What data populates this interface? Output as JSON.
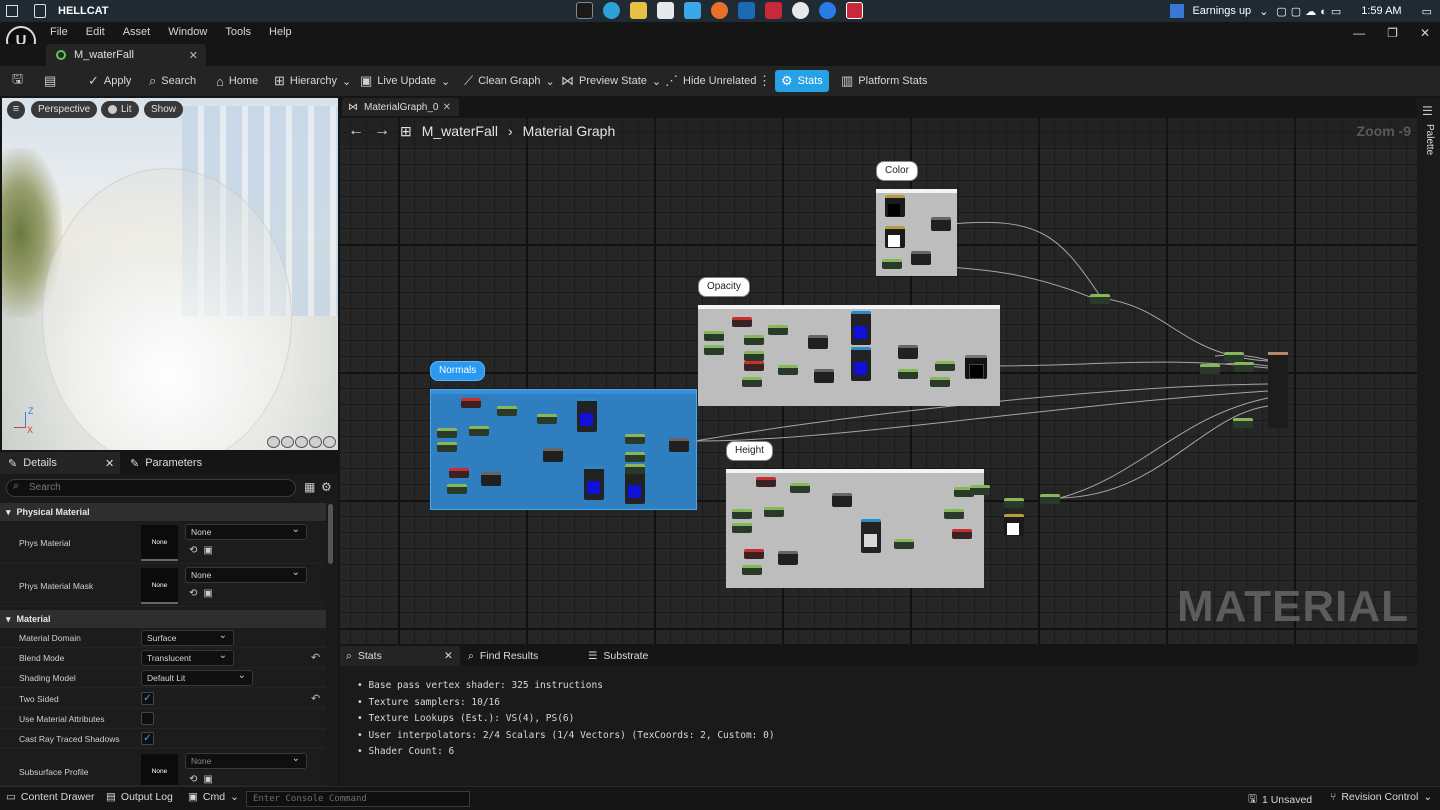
{
  "taskbar": {
    "window_title": "HELLCAT",
    "weather_text": "Earnings up",
    "time": "1:59 AM"
  },
  "menubar": {
    "logo": "U",
    "items": [
      "File",
      "Edit",
      "Asset",
      "Window",
      "Tools",
      "Help"
    ]
  },
  "asset_tab": {
    "label": "M_waterFall"
  },
  "toolbar": {
    "apply": "Apply",
    "search": "Search",
    "home": "Home",
    "hierarchy": "Hierarchy",
    "live_update": "Live Update",
    "clean_graph": "Clean Graph",
    "preview_state": "Preview State",
    "hide_unrelated": "Hide Unrelated",
    "stats": "Stats",
    "platform_stats": "Platform Stats"
  },
  "viewport": {
    "perspective": "Perspective",
    "lit": "Lit",
    "show": "Show",
    "axis_z": "Z",
    "axis_x": "X"
  },
  "details": {
    "tab_details": "Details",
    "tab_parameters": "Parameters",
    "search_placeholder": "Search",
    "section_physical": "Physical Material",
    "phys_material": {
      "label": "Phys Material",
      "thumb": "None",
      "value": "None"
    },
    "phys_material_mask": {
      "label": "Phys Material Mask",
      "thumb": "None",
      "value": "None"
    },
    "section_material": "Material",
    "material_domain": {
      "label": "Material Domain",
      "value": "Surface"
    },
    "blend_mode": {
      "label": "Blend Mode",
      "value": "Translucent"
    },
    "shading_model": {
      "label": "Shading Model",
      "value": "Default Lit"
    },
    "two_sided": {
      "label": "Two Sided",
      "checked": true
    },
    "use_material_attributes": {
      "label": "Use Material Attributes",
      "checked": false
    },
    "cast_ray_traced_shadows": {
      "label": "Cast Ray Traced Shadows",
      "checked": true
    },
    "subsurface_profile": {
      "label": "Subsurface Profile",
      "thumb": "None",
      "value": "None"
    }
  },
  "graph": {
    "tab_label": "MaterialGraph_0",
    "breadcrumb_asset": "M_waterFall",
    "breadcrumb_graph": "Material Graph",
    "zoom": "Zoom -9",
    "watermark": "MATERIAL",
    "comments": [
      "Color",
      "Opacity",
      "Normals",
      "Height"
    ]
  },
  "palette": {
    "label": "Palette"
  },
  "stats_panel": {
    "tab_stats": "Stats",
    "tab_find": "Find Results",
    "tab_substrate": "Substrate",
    "lines": [
      "Base pass vertex shader: 325 instructions",
      "Texture samplers: 10/16",
      "Texture Lookups (Est.): VS(4), PS(6)",
      "User interpolators: 2/4 Scalars (1/4 Vectors) (TexCoords: 2, Custom: 0)",
      "Shader Count: 6"
    ]
  },
  "statusbar": {
    "content_drawer": "Content Drawer",
    "output_log": "Output Log",
    "cmd": "Cmd",
    "console_placeholder": "Enter Console Command",
    "unsaved": "1 Unsaved",
    "revision_control": "Revision Control"
  },
  "colors": {
    "accent": "#26a1e6",
    "panel": "#1a1a1a",
    "comment_blue": "#2f7fc0",
    "comment_gray": "#bdbdbd"
  }
}
